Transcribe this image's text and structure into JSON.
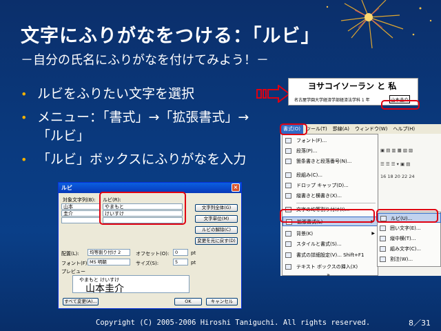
{
  "slide": {
    "title": "文字にふりがなをつける：「ルビ」",
    "subtitle": "－自分の氏名にふりがなを付けてみよう！－",
    "bullets": [
      "ルビをふりたい文字を選択",
      "メニュー：「書式」→「拡張書式」→\n「ルビ」",
      "「ルビ」ボックスにふりがなを入力"
    ],
    "footer": "Copyright (C) 2005-2006 Hiroshi Taniguchi. All rights reserved.",
    "page_number": "8／31"
  },
  "dialog": {
    "title": "ルビ",
    "target_label": "対象文字列(B):",
    "ruby_label": "ルビ(R):",
    "targets": [
      "山本",
      "圭介"
    ],
    "rubies": [
      "やまもと",
      "けいすけ"
    ],
    "buttons": {
      "all": "文字列全体(G)",
      "per_char": "文字単位(M)",
      "remove": "ルビの解除(C)",
      "reset": "変更を元に戻す(D)",
      "apply_all": "すべて変更(A)...",
      "ok": "OK",
      "cancel": "キャンセル"
    },
    "align_label": "配置(L):",
    "align_value": "均等割り付け 2",
    "offset_label": "オフセット(O):",
    "offset_value": "0",
    "font_label": "フォント(F):",
    "font_value": "MS 明朝",
    "size_label": "サイズ(S):",
    "size_value": "5",
    "unit": "pt",
    "preview_label": "プレビュー",
    "preview_ruby": "やまもと けいすけ",
    "preview_base": "山本圭介",
    "close_glyph": "×"
  },
  "doc_snippet": {
    "heading": "ヨサコイソーラン と 私",
    "line": "名古屋学園大学経済学部経済法学科 1 年",
    "name": "山本圭介"
  },
  "word_menu": {
    "menubar": [
      "書式(O)",
      "ツール(T)",
      "罫線(A)",
      "ウィンドウ(W)",
      "ヘルプ(H)"
    ],
    "items": [
      "フォント(F)...",
      "段落(P)...",
      "箇条書きと段落番号(N)...",
      "段組み(C)...",
      "ドロップ キャップ(D)...",
      "縦書きと横書き(X)...",
      "文字の均等割り付け(I)...",
      "拡張書式(L)",
      "背景(K)",
      "スタイルと書式(S)...",
      "書式の詳細設定(V)...  Shift+F1",
      "テキスト ボックスの挿入(X)"
    ],
    "submenu": [
      "ルビ(U)...",
      "囲い文字(E)...",
      "縦中横(T)...",
      "組み文字(C)...",
      "割注(W)..."
    ],
    "ruler": "16  18  20  22  24",
    "more_glyph": "»",
    "submenu_arrow": "▶"
  },
  "colors": {
    "background": "#0a3a7f",
    "bullet": "#f0b000",
    "highlight": "#e00010"
  }
}
